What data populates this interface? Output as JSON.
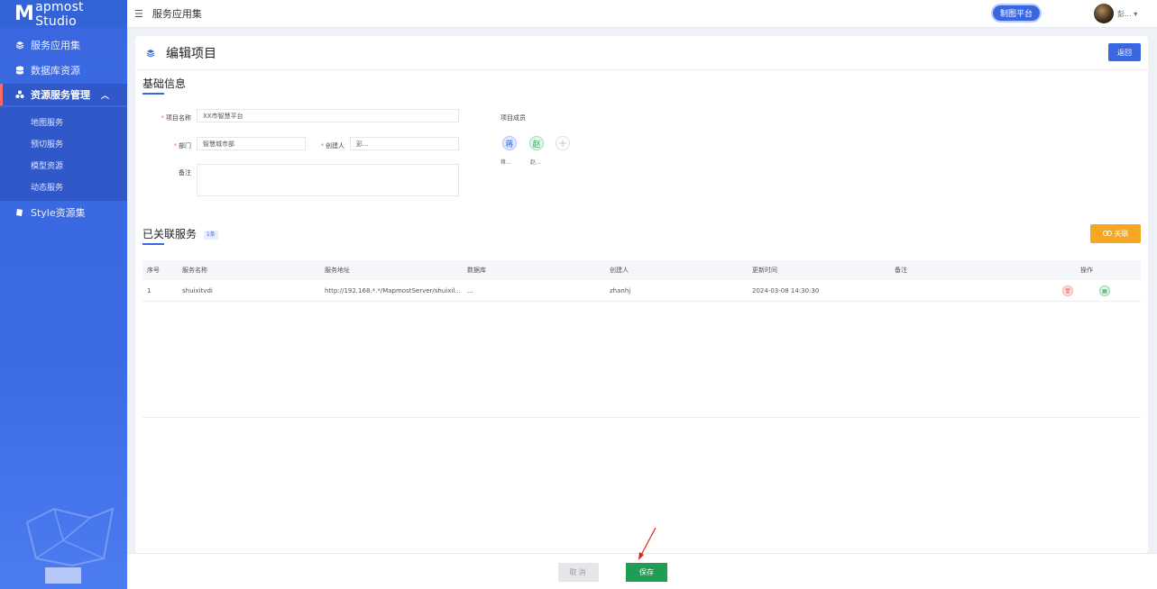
{
  "app": {
    "logo_m": "M",
    "logo_text": "apmost Studio"
  },
  "sidebar": {
    "items": [
      {
        "label": "服务应用集",
        "icon": "layers-icon"
      },
      {
        "label": "数据库资源",
        "icon": "database-icon"
      },
      {
        "label": "资源服务管理",
        "icon": "cluster-icon",
        "active": true
      },
      {
        "label": "Style资源集",
        "icon": "style-icon"
      }
    ],
    "submenu": [
      "地图服务",
      "预切服务",
      "模型资源",
      "动态服务"
    ]
  },
  "topbar": {
    "title": "服务应用集",
    "platform_button": "制图平台",
    "username": "彭..."
  },
  "page": {
    "title": "编辑项目",
    "back_button": "返回"
  },
  "basic_info": {
    "section_title": "基础信息",
    "project_name_label": "项目名称",
    "project_name_value": "XX市智慧平台",
    "department_label": "部门",
    "department_value": "智慧城市部",
    "creator_label": "创建人",
    "creator_value": "彭...",
    "remark_label": "备注",
    "remark_value": "",
    "members_label": "项目成员",
    "members": [
      {
        "avatar": "蒋",
        "name": "蒋..."
      },
      {
        "avatar": "赵",
        "name": "赵..."
      }
    ],
    "add_member": "+"
  },
  "linked_services": {
    "section_title": "已关联服务",
    "count_badge": "1条",
    "link_button": "关联",
    "columns": [
      "序号",
      "服务名称",
      "服务地址",
      "数据库",
      "创建人",
      "更新时间",
      "备注",
      "操作"
    ],
    "rows": [
      {
        "index": "1",
        "name": "shuixitvdi",
        "address": "http://192.168.*.*/MapmostServer/shuixil...",
        "database": "...",
        "creator": "zhanhj",
        "updated": "2024-03-08 14:30:30",
        "remark": ""
      }
    ]
  },
  "footer": {
    "cancel_button": "取消",
    "save_button": "保存"
  },
  "colors": {
    "primary": "#3a67e0",
    "save": "#1f9d55",
    "link_button": "#f5a623",
    "required": "#f56c6c"
  }
}
